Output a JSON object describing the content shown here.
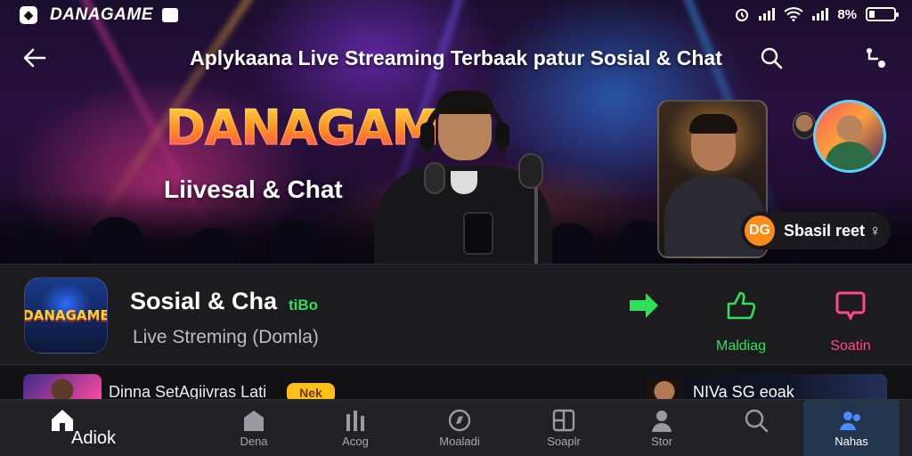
{
  "status_bar": {
    "app_name": "DANAGAME",
    "logo_glyph": "◆",
    "time_icon": "alarm-icon",
    "signal_text": "8%"
  },
  "header": {
    "back_icon": "back-arrow-icon",
    "title": "Aplykaana Live Streaming Terbaak patur Sosial & Chat",
    "search_icon": "search-icon",
    "share_icon": "share-icon"
  },
  "hero": {
    "brand": "DANAGAME",
    "tagline": "Liivesal & Chat",
    "avatar_large_text": "",
    "chip_icon": "dg-coin-icon",
    "chip_glyph": "DG",
    "chip_label": "Sbasil reet ♀"
  },
  "app_info": {
    "icon_text": "DANAGAME",
    "name": "Sosial & Cha",
    "tag": "tiBo",
    "subtitle": "Live Streming (Domla)",
    "actions": [
      {
        "label": "",
        "icon": "arrow-right-icon",
        "color": "#2ee05a"
      },
      {
        "label": "Maldiag",
        "icon": "thumbs-up-icon",
        "color": "#2ee05a"
      },
      {
        "label": "Soatin",
        "icon": "chat-bubble-icon",
        "color": "#ff4a8a"
      }
    ]
  },
  "strip": {
    "left_text": "Dinna SetAgiivras Lati",
    "badge": "Nek",
    "right_text": "NIVa SG eoak"
  },
  "bottom_nav": [
    {
      "label": "Adiok",
      "icon": "home-icon"
    },
    {
      "label": "Dena",
      "icon": "house-icon"
    },
    {
      "label": "Acog",
      "icon": "stats-icon"
    },
    {
      "label": "Moaladi",
      "icon": "compass-icon"
    },
    {
      "label": "Soaplr",
      "icon": "grid-icon"
    },
    {
      "label": "Stor",
      "icon": "profile-icon"
    },
    {
      "label": "",
      "icon": "search-icon"
    },
    {
      "label": "Nahas",
      "icon": "users-icon"
    }
  ],
  "colors": {
    "accent_green": "#2ee05a",
    "accent_pink": "#ff4a8a",
    "badge_yellow": "#ffbf1a",
    "nav_selected": "#24364e"
  }
}
